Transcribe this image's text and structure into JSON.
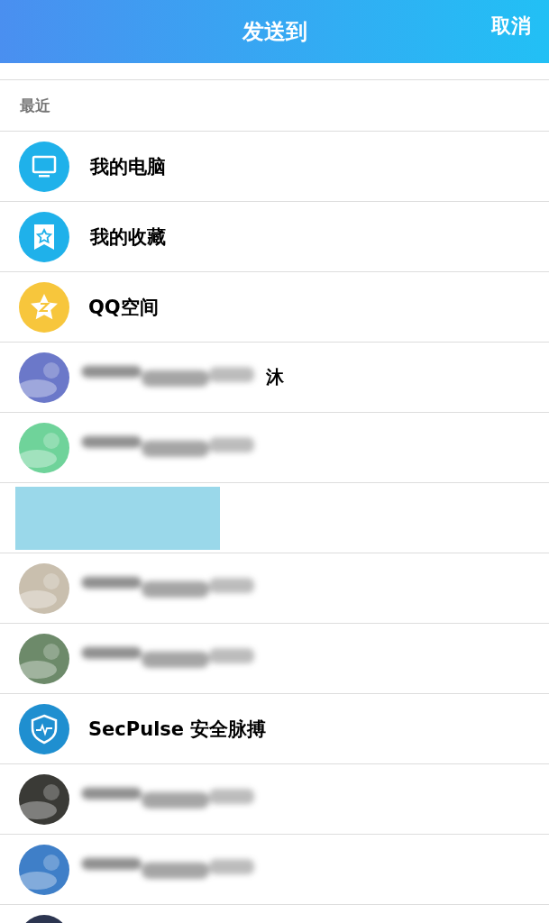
{
  "header": {
    "title": "发送到",
    "cancel": "取消"
  },
  "section": {
    "title": "最近"
  },
  "items": [
    {
      "kind": "device",
      "name": "我的电脑"
    },
    {
      "kind": "favorites",
      "name": "我的收藏"
    },
    {
      "kind": "qzone",
      "name": "QQ空间"
    },
    {
      "kind": "redacted",
      "color": "#6b78c9",
      "smudge": true,
      "fragment": "沐"
    },
    {
      "kind": "redacted",
      "color": "#6fd39a",
      "smudge": true
    },
    {
      "kind": "block"
    },
    {
      "kind": "redacted",
      "color": "#c9bfae",
      "smudge": true
    },
    {
      "kind": "redacted",
      "color": "#6d8a6a",
      "smudge": true
    },
    {
      "kind": "official",
      "name": "SecPulse 安全脉搏"
    },
    {
      "kind": "redacted",
      "color": "#3a3a36",
      "smudge": true
    },
    {
      "kind": "redacted",
      "color": "#3f7fc8",
      "smudge": true
    },
    {
      "kind": "redacted",
      "color": "#2c3550",
      "smudge": false
    }
  ]
}
